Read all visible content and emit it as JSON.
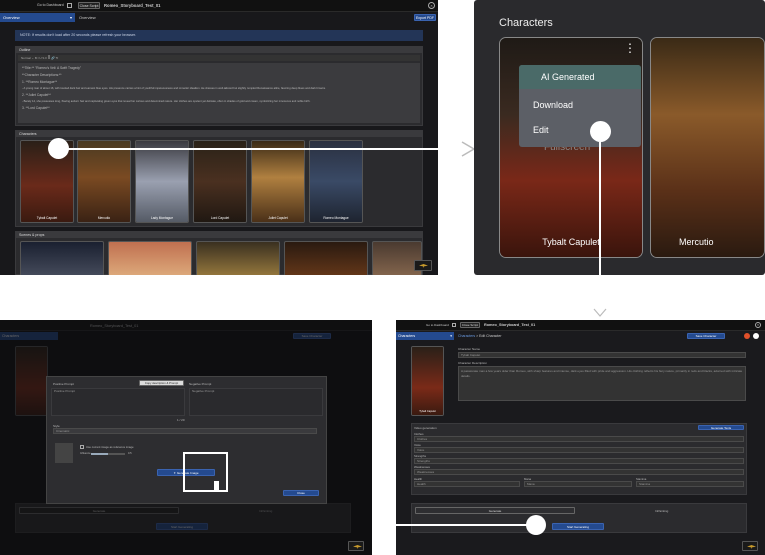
{
  "top": {
    "back_label": "Go to Dashboard",
    "close_label": "Close Script",
    "project_title": "Romeo_Storyboard_Test_01"
  },
  "p1": {
    "dropdown": "Overview",
    "section": "Overview",
    "export": "Export PDF",
    "notice": "NOTE: If results don't load after 20 seconds please refresh your browser.",
    "outline_header": "Outline",
    "editor_toolbar": "Normal ⌄  B  I  U  S  ≡  ≣  🔗  ⟲",
    "outline_lines": [
      "**Title:** \"Romeo's Veil: A Swift Tragedy\"",
      "**Character Descriptions:**",
      "1. **Romeo Montague**",
      "- A young man of about 16, with tousled dark hair and earnest blue eyes. His presence carries a hint of youthful impetuousness and romantic idealism. He dresses in well-tailored but slightly rumpled Renaissance attire, favoring deep blues and dark browns.",
      "2. **Juliet Capulet**",
      "- Barely 14, she possesses long, flowing auburn hair and captivating green eyes that reveal her curious and determined nature. Her clothes are opulent yet delicate, often in shades of gold and cream, symbolizing her innocence and noble birth.",
      "3. **Lord Capulet**"
    ],
    "characters_header": "Characters",
    "characters": [
      "Tybalt Capulet",
      "Mercutio",
      "Lady Montague",
      "Lord Capulet",
      "Juliet Capulet",
      "Romeo Montague"
    ],
    "scenes_header": "Scenes & props"
  },
  "p2": {
    "title": "Characters",
    "menu": [
      "AI Generated",
      "Download",
      "Edit"
    ],
    "hidden_label": "Fullscreen",
    "cards": [
      "Tybalt Capulet",
      "Mercutio"
    ]
  },
  "p3": {
    "dropdown": "Characters",
    "crumb1": "Characters",
    "crumb_sep": ">",
    "crumb2": "Edit Character",
    "save": "Save Character",
    "name_label": "Character Name",
    "name_value": "Tybalt Capulet",
    "desc_label": "Character Description",
    "desc_value": "A passionate man a few years older than Romeo, with sharp features and intense, dark eyes filled with pride and aggression. His clothing reflects his fiery nature, primarily in reds and blacks, adorned with intricate details.",
    "card_name": "Tybalt Capulet",
    "video_label": "Video generation",
    "gen_texts": "Generate Texts",
    "fields": [
      {
        "label": "Clothes",
        "value": "Clothes"
      },
      {
        "label": "Voice",
        "value": "Voice"
      },
      {
        "label": "Strengths",
        "value": "Strengths"
      },
      {
        "label": "Weaknesses",
        "value": "Weaknesses"
      }
    ],
    "row3": [
      {
        "label": "Health",
        "value": "Health"
      },
      {
        "label": "Mana",
        "value": "Mana"
      },
      {
        "label": "Stamina",
        "value": "Stamina"
      }
    ],
    "generate": "Generate",
    "inpainting": "InPainting",
    "start": "Start Generating"
  },
  "p4": {
    "crumb": "Romeo_Storyboard_Test_01",
    "dropdown": "Characters",
    "save": "Save Character",
    "positive_label": "Positive Prompt",
    "copy_btn": "Copy description & Prompt",
    "negative_label": "Negative Prompt",
    "positive_ph": "Positive Prompt",
    "negative_ph": "Negative Prompt",
    "counter": "1 / 20",
    "style_label": "Style",
    "style_value": "Cinematic",
    "checkbox": "Use current image as reference image",
    "influence": "Influence",
    "influence_val": "0.5",
    "generate_img": "Generate Image",
    "close": "Close",
    "generate": "Generate",
    "inpainting": "InPainting",
    "start": "Start Generating"
  }
}
